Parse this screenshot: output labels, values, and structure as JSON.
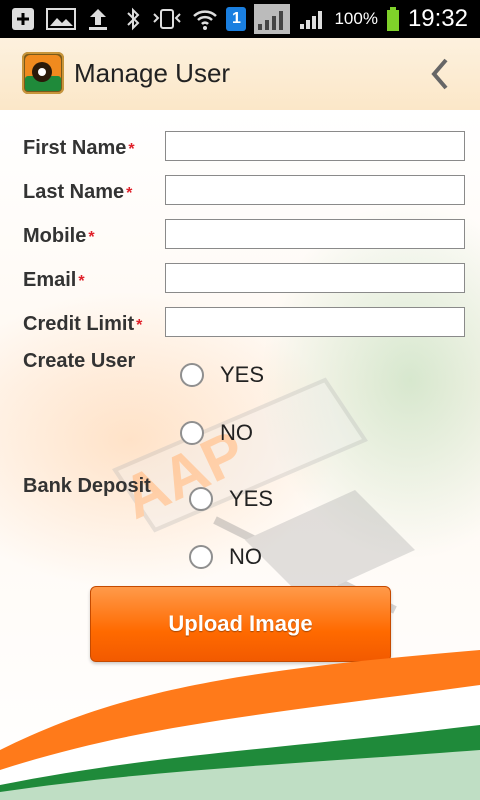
{
  "status_bar": {
    "battery": "100%",
    "time": "19:32",
    "notification_count": "1"
  },
  "header": {
    "title": "Manage User"
  },
  "form": {
    "first_name_label": "First Name",
    "last_name_label": "Last Name",
    "mobile_label": "Mobile",
    "email_label": "Email",
    "credit_limit_label": "Credit Limit",
    "required_mark": "*",
    "create_user_label": "Create User",
    "bank_deposit_label": "Bank Deposit",
    "yes": "YES",
    "no": "NO",
    "first_name_value": "",
    "last_name_value": "",
    "mobile_value": "",
    "email_value": "",
    "credit_limit_value": ""
  },
  "actions": {
    "upload_label": "Upload Image"
  },
  "colors": {
    "accent_orange": "#ff6a00",
    "required_red": "#e0202a"
  }
}
